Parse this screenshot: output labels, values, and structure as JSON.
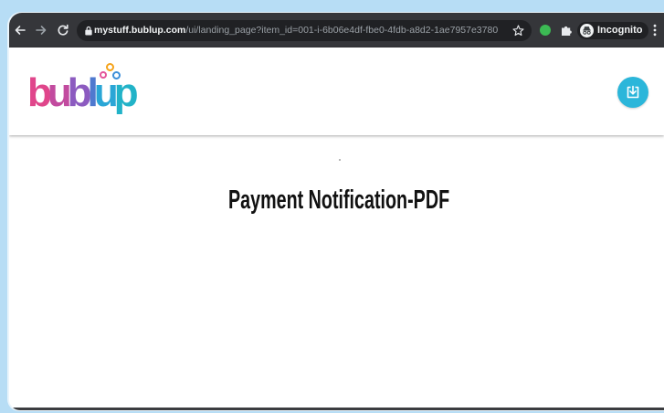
{
  "browser": {
    "mode": "incognito",
    "nav_icons": [
      "back-arrow-icon",
      "forward-arrow-icon",
      "reload-icon"
    ],
    "address_bar": {
      "secure_icon": "lock-icon",
      "domain": "mystuff.bublup.com",
      "path": "/ui/landing_page?item_id=001-i-6b06e4df-fbe0-4fdb-a8d2-1ae7957e3780",
      "bookmark_icon": "star-icon"
    },
    "extensions": [
      "green-extension-icon",
      "puzzle-extensions-icon"
    ],
    "profile": {
      "icon": "incognito-icon",
      "label": "Incognito"
    },
    "menu_icon": "kebab-menu-icon"
  },
  "header": {
    "logo": {
      "letters": [
        {
          "ch": "b",
          "color": "#e0468b"
        },
        {
          "ch": "u",
          "color": "#c24b9f"
        },
        {
          "ch": "b",
          "color": "#8c5bc0"
        },
        {
          "ch": "l",
          "color": "#4f79cf"
        },
        {
          "ch": "u",
          "color": "#2aa6d6"
        },
        {
          "ch": "p",
          "color": "#22b3c8"
        }
      ],
      "bubble_colors": [
        "#f5a31a",
        "#e4559a",
        "#3d8fd8"
      ]
    },
    "download_button": {
      "icon": "download-icon",
      "color": "#2bb6da"
    }
  },
  "main": {
    "title": "Payment Notification-PDF"
  },
  "colors": {
    "backdrop": "#b7ddf5",
    "toolbar": "#35363a",
    "omnibox": "#202124",
    "accent": "#2bb6da"
  }
}
